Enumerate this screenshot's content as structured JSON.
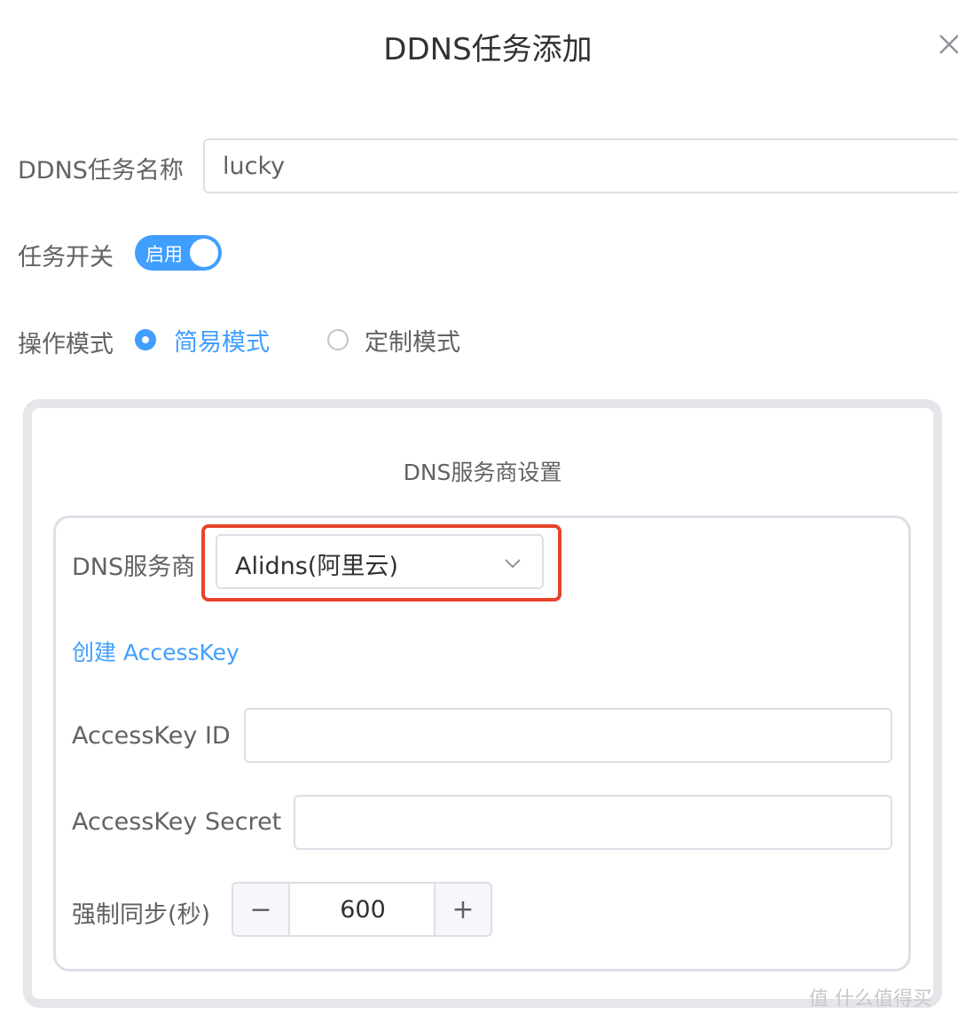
{
  "dialog": {
    "title": "DDNS任务添加",
    "close_icon": "close-icon"
  },
  "form": {
    "task_name": {
      "label": "DDNS任务名称",
      "value": "lucky"
    },
    "task_switch": {
      "label": "任务开关",
      "on_text": "启用",
      "checked": true
    },
    "mode": {
      "label": "操作模式",
      "options": [
        {
          "label": "简易模式",
          "selected": true
        },
        {
          "label": "定制模式",
          "selected": false
        }
      ]
    }
  },
  "dns_section": {
    "title": "DNS服务商设置",
    "provider": {
      "label": "DNS服务商",
      "value": "Alidns(阿里云)",
      "icon": "chevron-down-icon"
    },
    "create_link": "创建 AccessKey",
    "access_key_id": {
      "label": "AccessKey ID",
      "value": ""
    },
    "access_key_secret": {
      "label": "AccessKey Secret",
      "value": ""
    },
    "force_sync": {
      "label": "强制同步(秒)",
      "value": "600",
      "minus": "−",
      "plus": "+"
    }
  },
  "watermark": "值 什么值得买",
  "colors": {
    "primary": "#409eff",
    "highlight": "#e8432c",
    "border": "#dcdfe6"
  }
}
